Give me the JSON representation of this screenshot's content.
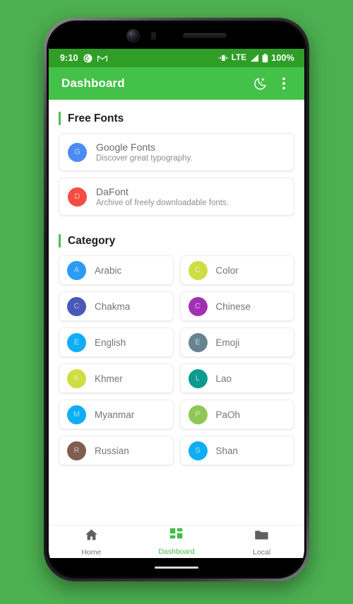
{
  "theme": {
    "page_background": "#4CAF50",
    "status_bar_color": "#2E9E26",
    "app_bar_color": "#44C148",
    "accent_color": "#4CC04F",
    "active_nav_color": "#3FBF43"
  },
  "status_bar": {
    "time": "9:10",
    "left_icons": [
      "pocketcasts-icon",
      "gmail-icon"
    ],
    "vibrate_icon": "vibrate-icon",
    "network_type": "LTE",
    "signal_icon": "signal-bars-icon",
    "battery_icon": "battery-full-icon",
    "battery_level": "100%"
  },
  "app_bar": {
    "title": "Dashboard",
    "actions": [
      {
        "name": "night-mode-icon",
        "label": "Night mode"
      },
      {
        "name": "overflow-menu-icon",
        "label": "More options"
      }
    ]
  },
  "sections": {
    "free_fonts": {
      "title": "Free Fonts",
      "items": [
        {
          "initial": "G",
          "color": "#4285F4",
          "title": "Google Fonts",
          "subtitle": "Discover great typography."
        },
        {
          "initial": "D",
          "color": "#F44336",
          "title": "DaFont",
          "subtitle": "Archive of freely downloadable fonts."
        }
      ]
    },
    "category": {
      "title": "Category",
      "items": [
        {
          "initial": "A",
          "label": "Arabic",
          "color": "#2196F3"
        },
        {
          "initial": "C",
          "label": "Color",
          "color": "#CDDC39"
        },
        {
          "initial": "C",
          "label": "Chakma",
          "color": "#3F51B5"
        },
        {
          "initial": "C",
          "label": "Chinese",
          "color": "#9C27B0"
        },
        {
          "initial": "E",
          "label": "English",
          "color": "#03A9F4"
        },
        {
          "initial": "E",
          "label": "Emoji",
          "color": "#607D8B"
        },
        {
          "initial": "K",
          "label": "Khmer",
          "color": "#CDDC39"
        },
        {
          "initial": "L",
          "label": "Lao",
          "color": "#009688"
        },
        {
          "initial": "M",
          "label": "Myanmar",
          "color": "#03A9F4"
        },
        {
          "initial": "P",
          "label": "PaOh",
          "color": "#8BC34A"
        },
        {
          "initial": "R",
          "label": "Russian",
          "color": "#795548"
        },
        {
          "initial": "S",
          "label": "Shan",
          "color": "#03A9F4"
        }
      ]
    }
  },
  "bottom_nav": {
    "items": [
      {
        "label": "Home",
        "icon": "home-icon",
        "active": false
      },
      {
        "label": "Dashboard",
        "icon": "dashboard-icon",
        "active": true
      },
      {
        "label": "Local",
        "icon": "folder-icon",
        "active": false
      }
    ]
  }
}
